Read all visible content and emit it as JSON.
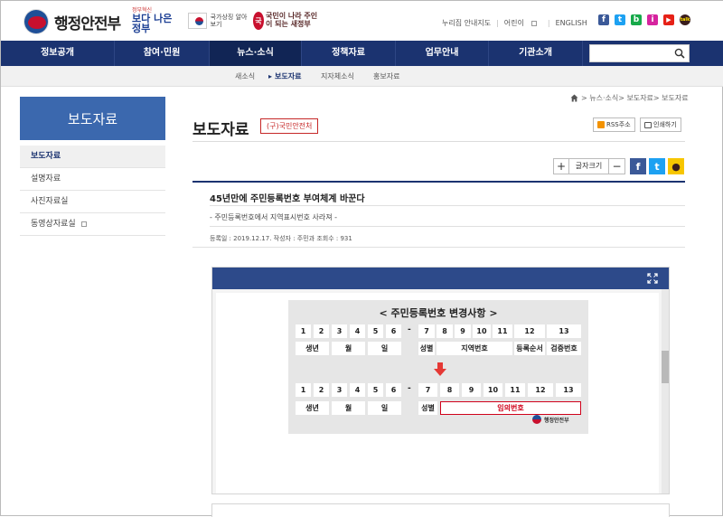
{
  "header": {
    "logo_text": "행정안전부",
    "banner1_small": "정부혁신",
    "banner1_main": "보다 나은 정부",
    "banner2_text": "국가상징 알아보기",
    "banner3_text": "국민이 나라 주인이 되는 새정부"
  },
  "toplinks": {
    "sitemap": "누리집 안내지도",
    "kids": "어린이",
    "english": "ENGLISH"
  },
  "social": [
    "f",
    "t",
    "b",
    "i",
    "▶",
    "talk"
  ],
  "nav": {
    "items": [
      "정보공개",
      "참여·민원",
      "뉴스·소식",
      "정책자료",
      "업무안내",
      "기관소개"
    ],
    "active_index": 2,
    "search_placeholder": ""
  },
  "subnav": {
    "items": [
      "새소식",
      "보도자료",
      "지자체소식",
      "홍보자료"
    ],
    "active_index": 1
  },
  "breadcrumb": {
    "path": "> 뉴스·소식> 보도자료> 보도자료"
  },
  "sidebar": {
    "heading": "보도자료",
    "items": [
      "보도자료",
      "설명자료",
      "사진자료실",
      "동영상자료실"
    ],
    "active_index": 0
  },
  "content": {
    "title": "보도자료",
    "tag": "(구)국민안전처",
    "rss_label": "RSS주소",
    "print_label": "인쇄하기",
    "fontsize_plus": "+",
    "fontsize_label": "글자크기",
    "fontsize_minus": "−"
  },
  "article": {
    "title": "45년만에 주민등록번호 부여체계 바꾼다",
    "subtitle": "- 주민등록번호에서 지역표시번호 사라져 -",
    "meta": "등록일 : 2019.12.17.    작성자 : 주민과    조회수 : 931"
  },
  "infographic": {
    "title": "< 주민등록번호 변경사항 >",
    "numbers_top": [
      "1",
      "2",
      "3",
      "4",
      "5",
      "6",
      "7",
      "8",
      "9",
      "10",
      "11",
      "12",
      "13"
    ],
    "labels_top": [
      "생년",
      "월",
      "일",
      "성별",
      "지역번호",
      "등록순서",
      "검증번호"
    ],
    "numbers_bottom": [
      "1",
      "2",
      "3",
      "4",
      "5",
      "6",
      "7",
      "8",
      "9",
      "10",
      "11",
      "12",
      "13"
    ],
    "labels_bottom": [
      "생년",
      "월",
      "일",
      "성별",
      "임의번호"
    ],
    "dash": "-",
    "logo_text": "행정안전부"
  },
  "colors": {
    "nav_bg": "#1b3370",
    "sidebar_head": "#3b68ae",
    "accent_red": "#c62828",
    "viewer_bar": "#2d4a8a"
  }
}
